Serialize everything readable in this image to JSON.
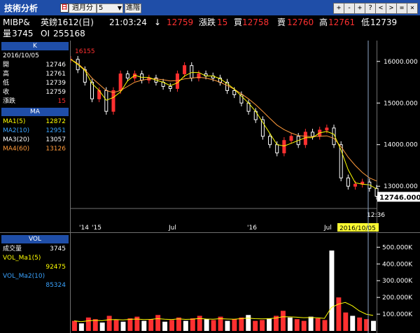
{
  "toolbar": {
    "app_title": "技術分析",
    "period_icon": "日",
    "period_label": "週月分",
    "interval_value": "5",
    "advanced_label": "進階",
    "window_buttons": [
      "+",
      "-",
      "+",
      "?",
      "<",
      ">",
      "=",
      "×"
    ]
  },
  "quote": {
    "symbol": "MIBP&",
    "name": "英鎊1612(日)",
    "time": "21:03:24",
    "arrow": "↓",
    "last": "12759",
    "change_label": "漲跌",
    "change": "15",
    "bid_label": "買",
    "bid": "12758",
    "ask_label": "賣",
    "ask": "12760",
    "high_label": "高",
    "high": "12761",
    "low_label": "低",
    "low": "12739",
    "volume_label": "量",
    "volume": "3745",
    "oi_label": "OI",
    "oi": "255168"
  },
  "kpanel": {
    "title": "K",
    "date": "2016/10/05",
    "rows": [
      {
        "label": "開",
        "value": "12746"
      },
      {
        "label": "高",
        "value": "12761"
      },
      {
        "label": "低",
        "value": "12739"
      },
      {
        "label": "收",
        "value": "12759"
      },
      {
        "label": "漲跌",
        "value": "15"
      }
    ]
  },
  "mapanel": {
    "title": "MA",
    "rows": [
      {
        "label": "MA1(5)",
        "value": "12872",
        "color": "#ffff00"
      },
      {
        "label": "MA2(10)",
        "value": "12951",
        "color": "#3aa3ff"
      },
      {
        "label": "MA3(20)",
        "value": "13057",
        "color": "#ffffff"
      },
      {
        "label": "MA4(60)",
        "value": "13126",
        "color": "#ff9a3a"
      }
    ]
  },
  "volpanel": {
    "title": "VOL",
    "rows": [
      {
        "label": "成交量",
        "value": "3745"
      },
      {
        "label": "VOL_Ma1(5)",
        "value": "92475"
      },
      {
        "label": "VOL_Ma2(10)",
        "value": "85324"
      }
    ]
  },
  "chart_data": [
    {
      "type": "candlestick",
      "title": "",
      "highlight_label": "16155",
      "ylim": [
        12600,
        16400
      ],
      "ytick_labels": [
        "16000.000",
        "15000.000",
        "14000.000",
        "13000.000"
      ],
      "yticks": [
        16000,
        15000,
        14000,
        13000
      ],
      "current_price_label": "12746.000",
      "current_time_label": "12:36",
      "current_date_label": "2016/10/05",
      "xtick_labels": [
        "'14",
        "'15",
        "Jul",
        "'16",
        "Jul"
      ],
      "x": [
        0,
        10,
        20,
        30,
        40,
        50,
        60,
        70,
        80,
        90,
        100,
        110,
        120,
        130,
        140,
        150,
        160,
        170,
        180,
        190,
        200,
        210,
        220,
        230,
        240,
        250,
        260,
        270,
        280,
        290,
        300,
        310,
        320,
        330,
        340,
        350,
        360,
        370,
        380,
        390,
        400,
        410,
        420,
        430
      ],
      "close": [
        16050,
        15800,
        15500,
        15100,
        15300,
        14800,
        15300,
        15700,
        15600,
        15700,
        15550,
        15600,
        15500,
        15400,
        15350,
        15700,
        15900,
        15600,
        15700,
        15650,
        15600,
        15500,
        15300,
        15200,
        15000,
        14800,
        14600,
        14200,
        14000,
        13800,
        14100,
        14200,
        14000,
        14300,
        14200,
        14350,
        14400,
        14000,
        13200,
        13000,
        13050,
        13100,
        12950,
        12760
      ],
      "ma_long": [
        16050,
        15950,
        15800,
        15600,
        15450,
        15300,
        15250,
        15300,
        15400,
        15500,
        15550,
        15580,
        15580,
        15560,
        15530,
        15540,
        15580,
        15600,
        15620,
        15600,
        15560,
        15500,
        15420,
        15330,
        15220,
        15100,
        14960,
        14800,
        14630,
        14470,
        14360,
        14280,
        14220,
        14200,
        14190,
        14200,
        14210,
        14150,
        13950,
        13700,
        13500,
        13330,
        13200,
        13126
      ]
    },
    {
      "type": "bar",
      "title": "",
      "ylim": [
        0,
        560000
      ],
      "ytick_labels": [
        "500.000K",
        "400.000K",
        "300.000K",
        "200.000K",
        "100.000K"
      ],
      "yticks": [
        500000,
        400000,
        300000,
        200000,
        100000
      ],
      "values": [
        60000,
        45000,
        80000,
        70000,
        50000,
        90000,
        65000,
        55000,
        75000,
        85000,
        60000,
        70000,
        95000,
        55000,
        65000,
        80000,
        60000,
        75000,
        90000,
        70000,
        65000,
        85000,
        60000,
        70000,
        80000,
        95000,
        60000,
        65000,
        75000,
        90000,
        120000,
        80000,
        70000,
        60000,
        85000,
        75000,
        65000,
        480000,
        200000,
        110000,
        90000,
        80000,
        70000,
        60000
      ],
      "ma": [
        60000,
        55000,
        60000,
        63000,
        61000,
        67000,
        68000,
        66000,
        69000,
        71000,
        68000,
        69000,
        73000,
        70000,
        68000,
        72000,
        69000,
        70000,
        74000,
        71000,
        70000,
        73000,
        71000,
        70000,
        73000,
        76000,
        73000,
        72000,
        73000,
        77000,
        85000,
        84000,
        82000,
        79000,
        80000,
        78000,
        75000,
        140000,
        160000,
        170000,
        150000,
        120000,
        100000,
        92475
      ]
    }
  ]
}
